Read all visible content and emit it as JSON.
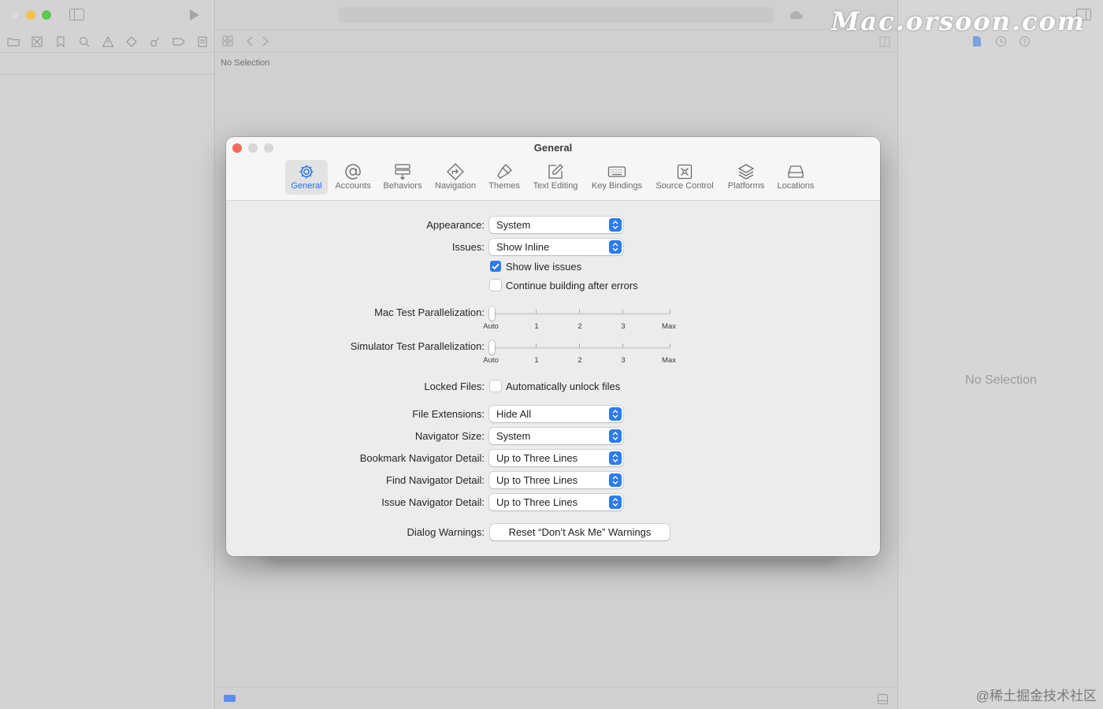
{
  "window": {
    "center_no_selection": "No Selection",
    "inspector_no_selection": "No Selection"
  },
  "watermarks": {
    "top_right": "Mac.orsoon.com",
    "bottom_right": "@稀土掘金技术社区"
  },
  "dialog": {
    "title": "General",
    "tabs": [
      {
        "label": "General",
        "icon": "gear-icon",
        "active": true
      },
      {
        "label": "Accounts",
        "icon": "at-sign-icon",
        "active": false
      },
      {
        "label": "Behaviors",
        "icon": "behaviors-icon",
        "active": false
      },
      {
        "label": "Navigation",
        "icon": "navigation-sign-icon",
        "active": false
      },
      {
        "label": "Themes",
        "icon": "brush-icon",
        "active": false
      },
      {
        "label": "Text Editing",
        "icon": "pencil-square-icon",
        "active": false
      },
      {
        "label": "Key Bindings",
        "icon": "keyboard-icon",
        "active": false
      },
      {
        "label": "Source Control",
        "icon": "source-control-icon",
        "active": false
      },
      {
        "label": "Platforms",
        "icon": "layers-icon",
        "active": false
      },
      {
        "label": "Locations",
        "icon": "drive-icon",
        "active": false
      }
    ],
    "appearance": {
      "label": "Appearance:",
      "value": "System"
    },
    "issues": {
      "label": "Issues:",
      "value": "Show Inline"
    },
    "show_live_issues": {
      "label": "Show live issues",
      "checked": true
    },
    "continue_building": {
      "label": "Continue building after errors",
      "checked": false
    },
    "mac_test_parallelization": {
      "label": "Mac Test Parallelization:",
      "value": "Auto"
    },
    "simulator_test_parallelization": {
      "label": "Simulator Test Parallelization:",
      "value": "Auto"
    },
    "slider_ticks": [
      "Auto",
      "1",
      "2",
      "3",
      "Max"
    ],
    "locked_files": {
      "label": "Locked Files:",
      "checkbox_label": "Automatically unlock files",
      "checked": false
    },
    "file_extensions": {
      "label": "File Extensions:",
      "value": "Hide All"
    },
    "navigator_size": {
      "label": "Navigator Size:",
      "value": "System"
    },
    "bookmark_navigator_detail": {
      "label": "Bookmark Navigator Detail:",
      "value": "Up to Three Lines"
    },
    "find_navigator_detail": {
      "label": "Find Navigator Detail:",
      "value": "Up to Three Lines"
    },
    "issue_navigator_detail": {
      "label": "Issue Navigator Detail:",
      "value": "Up to Three Lines"
    },
    "dialog_warnings": {
      "label": "Dialog Warnings:",
      "button": "Reset “Don’t Ask Me” Warnings"
    }
  },
  "colors": {
    "accent": "#2b7cf0",
    "close": "#ed6a5e",
    "minimize": "#f5bf4f",
    "zoom": "#61c554"
  }
}
